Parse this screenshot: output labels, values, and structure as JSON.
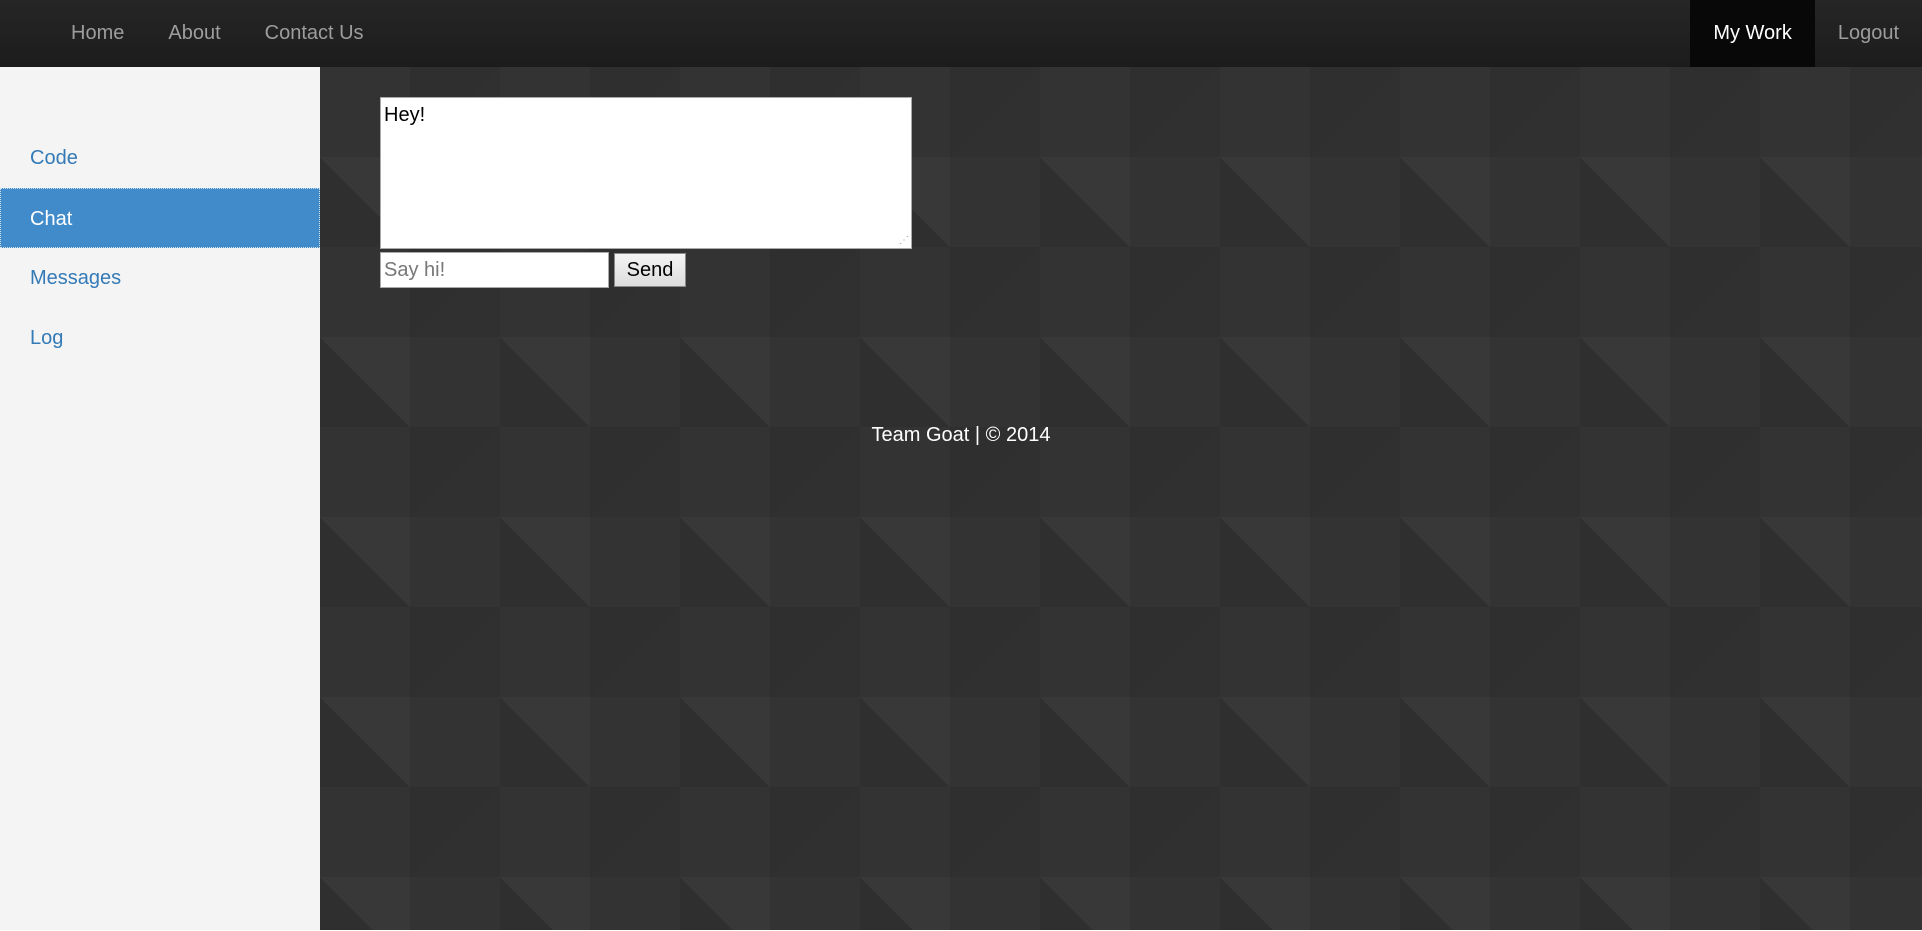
{
  "navbar": {
    "left_items": [
      {
        "label": "Home"
      },
      {
        "label": "About"
      },
      {
        "label": "Contact Us"
      }
    ],
    "right_items": [
      {
        "label": "My Work",
        "active": true
      },
      {
        "label": "Logout",
        "active": false
      }
    ]
  },
  "sidebar": {
    "items": [
      {
        "label": "Code"
      },
      {
        "label": "Chat",
        "active": true
      },
      {
        "label": "Messages"
      },
      {
        "label": "Log"
      }
    ]
  },
  "chat": {
    "log_text": "Hey!",
    "input_placeholder": "Say hi!",
    "input_value": "",
    "send_label": "Send"
  },
  "footer": {
    "text": "Team Goat | © 2014"
  },
  "colors": {
    "navbar_bg": "#222222",
    "active_nav_bg": "#080808",
    "sidebar_bg": "#f4f4f4",
    "sidebar_link": "#337ab7",
    "sidebar_active_bg": "#428bca",
    "main_bg": "#333333"
  }
}
